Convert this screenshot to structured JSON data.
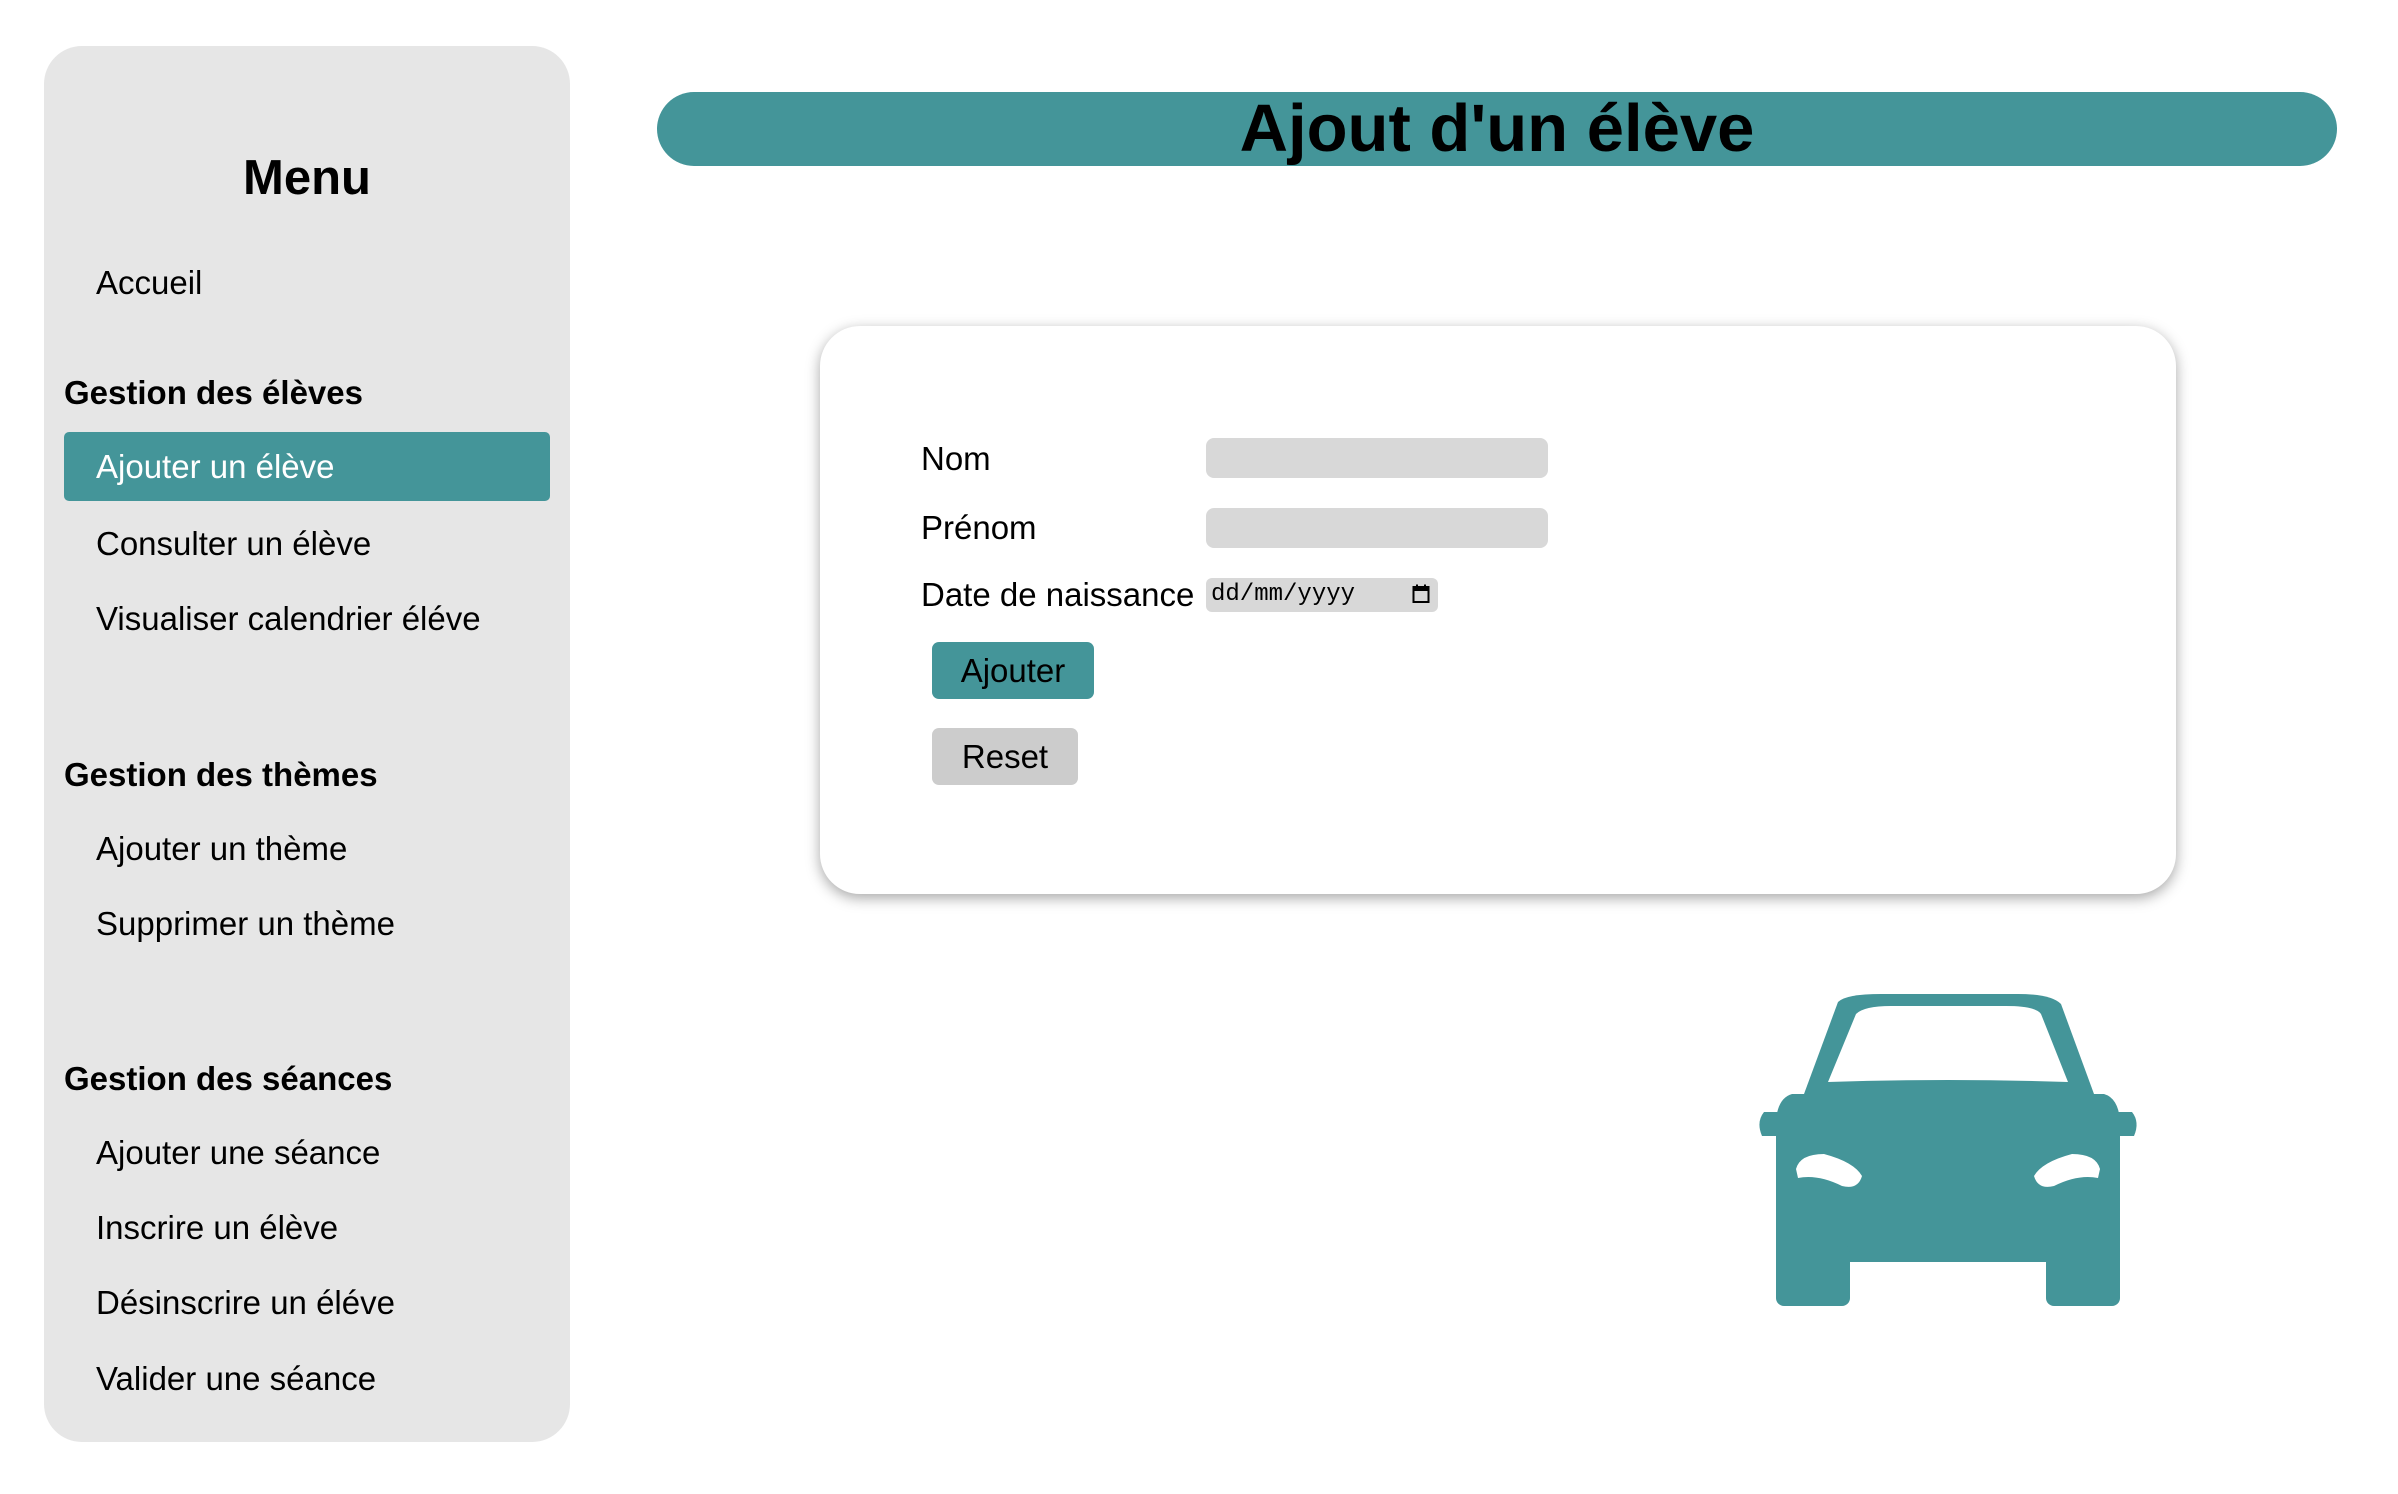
{
  "colors": {
    "accent": "#449599",
    "sidebar_bg": "#e6e6e6",
    "input_bg": "#d8d8d8",
    "reset_bg": "#cccccc"
  },
  "sidebar": {
    "title": "Menu",
    "home": "Accueil",
    "sections": [
      {
        "title": "Gestion des élèves",
        "items": [
          "Ajouter un élève",
          "Consulter un élève",
          "Visualiser calendrier éléve"
        ]
      },
      {
        "title": "Gestion des thèmes",
        "items": [
          "Ajouter un thème",
          "Supprimer un thème"
        ]
      },
      {
        "title": "Gestion des séances",
        "items": [
          "Ajouter une séance",
          "Inscrire un élève",
          "Désinscrire un éléve",
          "Valider une séance"
        ]
      }
    ],
    "active_item": "Ajouter un élève"
  },
  "header": {
    "title": "Ajout d'un élève"
  },
  "form": {
    "fields": {
      "nom": {
        "label": "Nom",
        "value": ""
      },
      "prenom": {
        "label": "Prénom",
        "value": ""
      },
      "date_naissance": {
        "label": "Date de naissance",
        "placeholder": "dd/mm/yyyy"
      }
    },
    "buttons": {
      "add": "Ajouter",
      "reset": "Reset"
    }
  },
  "illustration": {
    "icon": "car-icon"
  }
}
